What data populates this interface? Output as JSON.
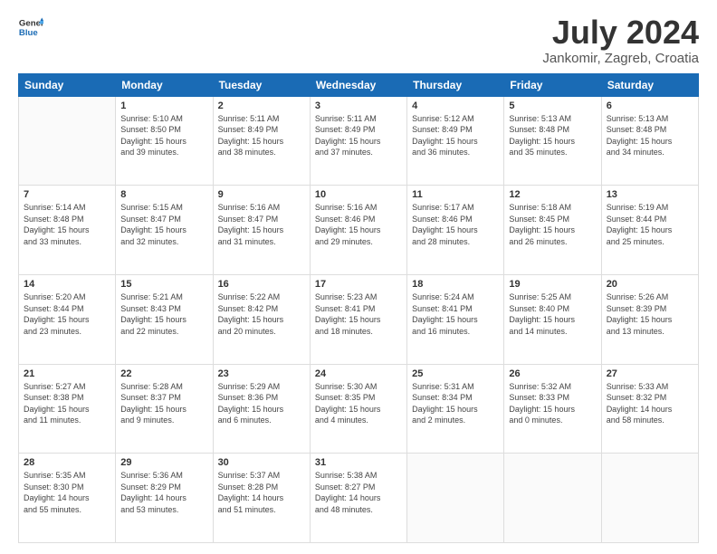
{
  "header": {
    "logo_line1": "General",
    "logo_line2": "Blue",
    "title": "July 2024",
    "subtitle": "Jankomir, Zagreb, Croatia"
  },
  "days_of_week": [
    "Sunday",
    "Monday",
    "Tuesday",
    "Wednesday",
    "Thursday",
    "Friday",
    "Saturday"
  ],
  "weeks": [
    [
      {
        "day": "",
        "info": ""
      },
      {
        "day": "1",
        "info": "Sunrise: 5:10 AM\nSunset: 8:50 PM\nDaylight: 15 hours\nand 39 minutes."
      },
      {
        "day": "2",
        "info": "Sunrise: 5:11 AM\nSunset: 8:49 PM\nDaylight: 15 hours\nand 38 minutes."
      },
      {
        "day": "3",
        "info": "Sunrise: 5:11 AM\nSunset: 8:49 PM\nDaylight: 15 hours\nand 37 minutes."
      },
      {
        "day": "4",
        "info": "Sunrise: 5:12 AM\nSunset: 8:49 PM\nDaylight: 15 hours\nand 36 minutes."
      },
      {
        "day": "5",
        "info": "Sunrise: 5:13 AM\nSunset: 8:48 PM\nDaylight: 15 hours\nand 35 minutes."
      },
      {
        "day": "6",
        "info": "Sunrise: 5:13 AM\nSunset: 8:48 PM\nDaylight: 15 hours\nand 34 minutes."
      }
    ],
    [
      {
        "day": "7",
        "info": "Sunrise: 5:14 AM\nSunset: 8:48 PM\nDaylight: 15 hours\nand 33 minutes."
      },
      {
        "day": "8",
        "info": "Sunrise: 5:15 AM\nSunset: 8:47 PM\nDaylight: 15 hours\nand 32 minutes."
      },
      {
        "day": "9",
        "info": "Sunrise: 5:16 AM\nSunset: 8:47 PM\nDaylight: 15 hours\nand 31 minutes."
      },
      {
        "day": "10",
        "info": "Sunrise: 5:16 AM\nSunset: 8:46 PM\nDaylight: 15 hours\nand 29 minutes."
      },
      {
        "day": "11",
        "info": "Sunrise: 5:17 AM\nSunset: 8:46 PM\nDaylight: 15 hours\nand 28 minutes."
      },
      {
        "day": "12",
        "info": "Sunrise: 5:18 AM\nSunset: 8:45 PM\nDaylight: 15 hours\nand 26 minutes."
      },
      {
        "day": "13",
        "info": "Sunrise: 5:19 AM\nSunset: 8:44 PM\nDaylight: 15 hours\nand 25 minutes."
      }
    ],
    [
      {
        "day": "14",
        "info": "Sunrise: 5:20 AM\nSunset: 8:44 PM\nDaylight: 15 hours\nand 23 minutes."
      },
      {
        "day": "15",
        "info": "Sunrise: 5:21 AM\nSunset: 8:43 PM\nDaylight: 15 hours\nand 22 minutes."
      },
      {
        "day": "16",
        "info": "Sunrise: 5:22 AM\nSunset: 8:42 PM\nDaylight: 15 hours\nand 20 minutes."
      },
      {
        "day": "17",
        "info": "Sunrise: 5:23 AM\nSunset: 8:41 PM\nDaylight: 15 hours\nand 18 minutes."
      },
      {
        "day": "18",
        "info": "Sunrise: 5:24 AM\nSunset: 8:41 PM\nDaylight: 15 hours\nand 16 minutes."
      },
      {
        "day": "19",
        "info": "Sunrise: 5:25 AM\nSunset: 8:40 PM\nDaylight: 15 hours\nand 14 minutes."
      },
      {
        "day": "20",
        "info": "Sunrise: 5:26 AM\nSunset: 8:39 PM\nDaylight: 15 hours\nand 13 minutes."
      }
    ],
    [
      {
        "day": "21",
        "info": "Sunrise: 5:27 AM\nSunset: 8:38 PM\nDaylight: 15 hours\nand 11 minutes."
      },
      {
        "day": "22",
        "info": "Sunrise: 5:28 AM\nSunset: 8:37 PM\nDaylight: 15 hours\nand 9 minutes."
      },
      {
        "day": "23",
        "info": "Sunrise: 5:29 AM\nSunset: 8:36 PM\nDaylight: 15 hours\nand 6 minutes."
      },
      {
        "day": "24",
        "info": "Sunrise: 5:30 AM\nSunset: 8:35 PM\nDaylight: 15 hours\nand 4 minutes."
      },
      {
        "day": "25",
        "info": "Sunrise: 5:31 AM\nSunset: 8:34 PM\nDaylight: 15 hours\nand 2 minutes."
      },
      {
        "day": "26",
        "info": "Sunrise: 5:32 AM\nSunset: 8:33 PM\nDaylight: 15 hours\nand 0 minutes."
      },
      {
        "day": "27",
        "info": "Sunrise: 5:33 AM\nSunset: 8:32 PM\nDaylight: 14 hours\nand 58 minutes."
      }
    ],
    [
      {
        "day": "28",
        "info": "Sunrise: 5:35 AM\nSunset: 8:30 PM\nDaylight: 14 hours\nand 55 minutes."
      },
      {
        "day": "29",
        "info": "Sunrise: 5:36 AM\nSunset: 8:29 PM\nDaylight: 14 hours\nand 53 minutes."
      },
      {
        "day": "30",
        "info": "Sunrise: 5:37 AM\nSunset: 8:28 PM\nDaylight: 14 hours\nand 51 minutes."
      },
      {
        "day": "31",
        "info": "Sunrise: 5:38 AM\nSunset: 8:27 PM\nDaylight: 14 hours\nand 48 minutes."
      },
      {
        "day": "",
        "info": ""
      },
      {
        "day": "",
        "info": ""
      },
      {
        "day": "",
        "info": ""
      }
    ]
  ]
}
